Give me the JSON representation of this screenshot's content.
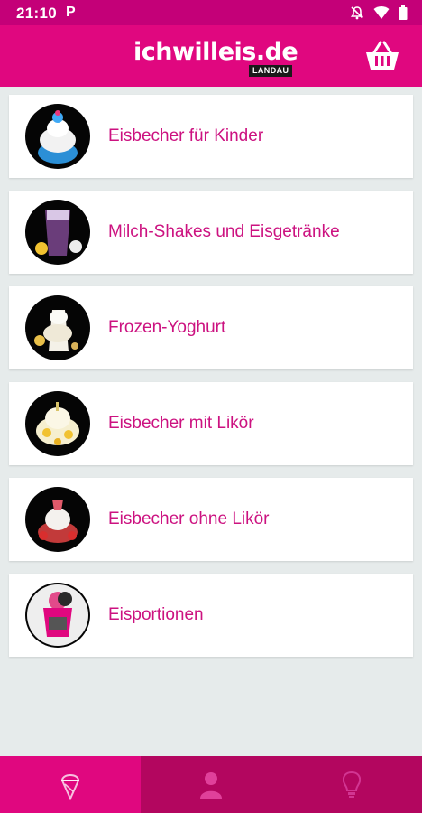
{
  "status_bar": {
    "time": "21:10",
    "indicator": "P",
    "icons": [
      "notifications-off-icon",
      "wifi-icon",
      "battery-icon"
    ]
  },
  "app_bar": {
    "logo_text": "ichwilleis.de",
    "logo_subtext": "LANDAU",
    "cart_icon": "basket-icon"
  },
  "categories": [
    {
      "label": "Eisbecher für Kinder"
    },
    {
      "label": "Milch-Shakes und Eisgetränke"
    },
    {
      "label": "Frozen-Yoghurt"
    },
    {
      "label": "Eisbecher mit Likör"
    },
    {
      "label": "Eisbecher ohne Likör"
    },
    {
      "label": "Eisportionen"
    }
  ],
  "bottom_nav": {
    "tabs": [
      {
        "icon": "ice-cream-icon",
        "active": true
      },
      {
        "icon": "person-icon",
        "active": false
      },
      {
        "icon": "lightbulb-icon",
        "active": false
      }
    ]
  },
  "colors": {
    "primary": "#e0077f",
    "status_bar": "#c40078",
    "bottom_nav": "#b3065f",
    "label": "#cc1280",
    "background": "#e6ebeb"
  }
}
